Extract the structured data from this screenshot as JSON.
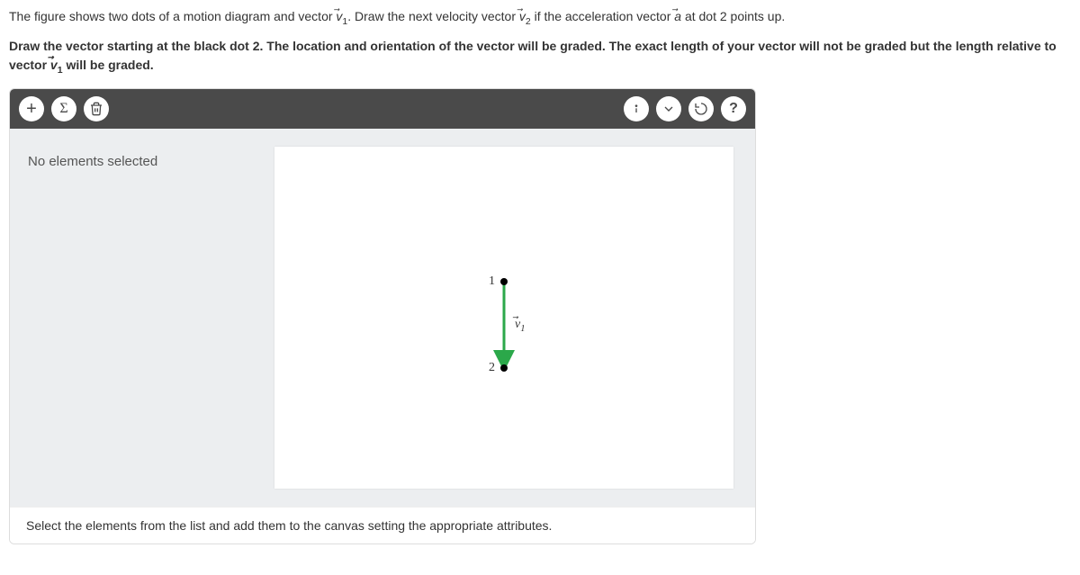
{
  "instructions": {
    "line1_parts": {
      "p1": "The figure shows two dots of a motion diagram and vector ",
      "v1": "v",
      "v1_sub": "1",
      "p2": ". Draw the next velocity vector ",
      "v2": "v",
      "v2_sub": "2",
      "p3": " if the acceleration vector ",
      "a": "a",
      "p4": " at dot 2 points up."
    },
    "line2_parts": {
      "p1": "Draw the vector starting at the black dot 2. The location and orientation of the vector will be graded. The exact length of your vector will not be graded but the length relative to vector ",
      "v1": "v",
      "v1_sub": "1",
      "p2": " will be graded."
    }
  },
  "toolbar": {
    "add_label": "+",
    "sigma_label": "Σ",
    "help_label": "?"
  },
  "sidebar": {
    "status": "No elements selected"
  },
  "canvas": {
    "dot1_label": "1",
    "dot2_label": "2",
    "vector_label": "v",
    "vector_sub": "1"
  },
  "footer": {
    "hint": "Select the elements from the list and add them to the canvas setting the appropriate attributes."
  }
}
